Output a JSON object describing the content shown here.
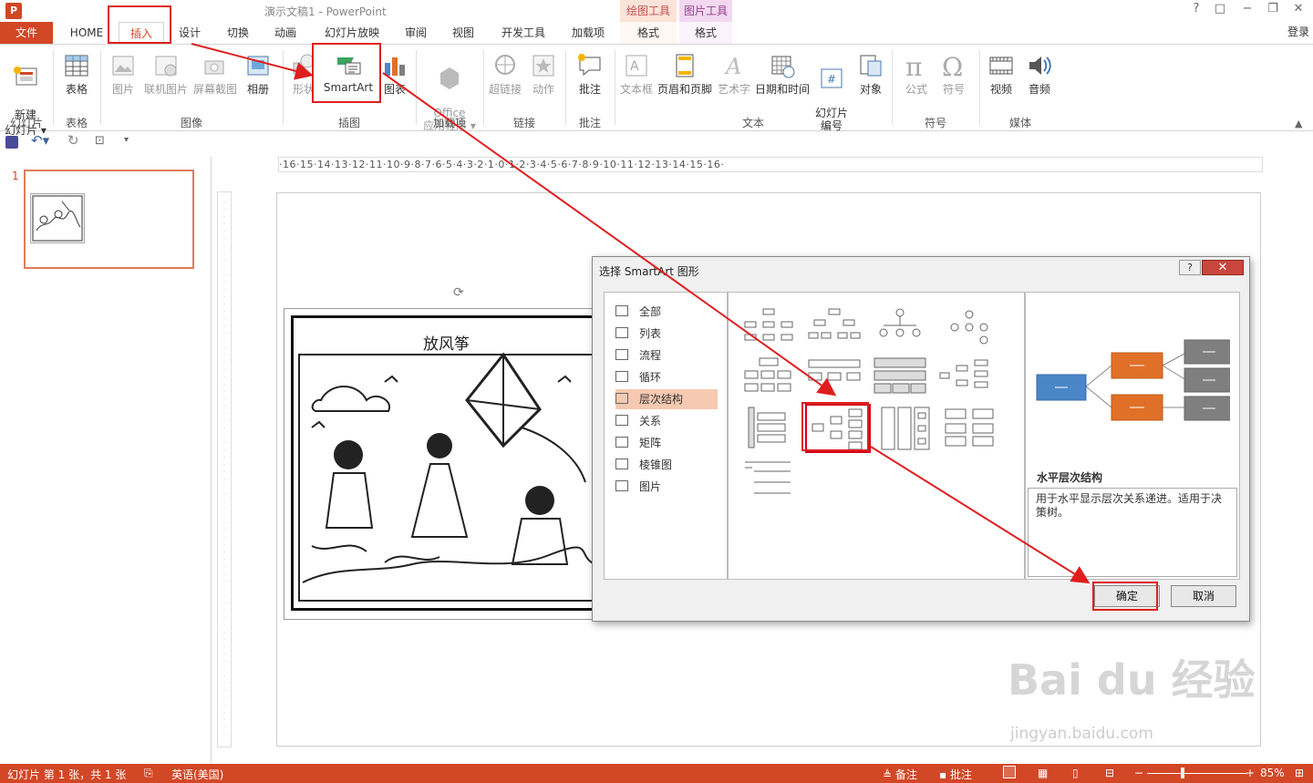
{
  "window": {
    "title": "演示文稿1 - PowerPoint",
    "login": "登录",
    "min": "?",
    "controls": [
      "?",
      "□",
      "−",
      "❐",
      "✕"
    ]
  },
  "context": {
    "draw_tools": "绘图工具",
    "pic_tools": "图片工具",
    "format": "格式"
  },
  "tabs": {
    "file": "文件",
    "home": "HOME",
    "insert": "插入",
    "design": "设计",
    "transitions": "切换",
    "animations": "动画",
    "slideshow": "幻灯片放映",
    "review": "审阅",
    "view": "视图",
    "developer": "开发工具",
    "addins": "加载项"
  },
  "ribbon": {
    "new_slide": "新建\n幻灯片 ▾",
    "table": "表格",
    "picture": "图片",
    "online_pic": "联机图片",
    "screenshot": "屏幕截图",
    "album": "相册",
    "shapes": "形状",
    "smartart": "SmartArt",
    "chart": "图表",
    "office_apps": "Office\n应用程序 ▾",
    "hyperlink": "超链接",
    "action": "动作",
    "comment": "批注",
    "textbox": "文本框",
    "header_footer": "页眉和页脚",
    "wordart": "艺术字",
    "datetime": "日期和时间",
    "slide_num": "幻灯片\n编号",
    "object": "对象",
    "equation": "公式",
    "symbol": "符号",
    "video": "视频",
    "audio": "音频",
    "groups": {
      "slides": "幻灯片",
      "tables": "表格",
      "images": "图像",
      "illustrations": "插图",
      "addins": "加载项",
      "links": "链接",
      "comments": "批注",
      "text": "文本",
      "symbols": "符号",
      "media": "媒体"
    }
  },
  "slides_pane": {
    "slide_number": "1"
  },
  "ruler": {
    "h": "·16·15·14·13·12·11·10·9·8·7·6·5·4·3·2·1·0·1·2·3·4·5·6·7·8·9·10·11·12·13·14·15·16·"
  },
  "slide": {
    "picture_title": "放风筝"
  },
  "dialog": {
    "title": "选择 SmartArt 图形",
    "help": "?",
    "close": "✕",
    "categories": [
      "全部",
      "列表",
      "流程",
      "循环",
      "层次结构",
      "关系",
      "矩阵",
      "棱锥图",
      "图片"
    ],
    "selected_category": "层次结构",
    "preview_name": "水平层次结构",
    "preview_desc": "用于水平显示层次关系递进。适用于决策树。",
    "ok": "确定",
    "cancel": "取消"
  },
  "status": {
    "slide_info": "幻灯片 第 1 张，共 1 张",
    "language": "英语(美国)",
    "notes": "备注",
    "comments": "批注",
    "zoom": "85%"
  },
  "watermark": {
    "main": "Bai du 经验",
    "sub": "jingyan.baidu.com"
  },
  "colors": {
    "accent": "#d24726",
    "annotation": "#e01e1e",
    "preview_blue": "#4a86c8",
    "preview_orange": "#e07028",
    "preview_gray": "#7f7f7f"
  }
}
